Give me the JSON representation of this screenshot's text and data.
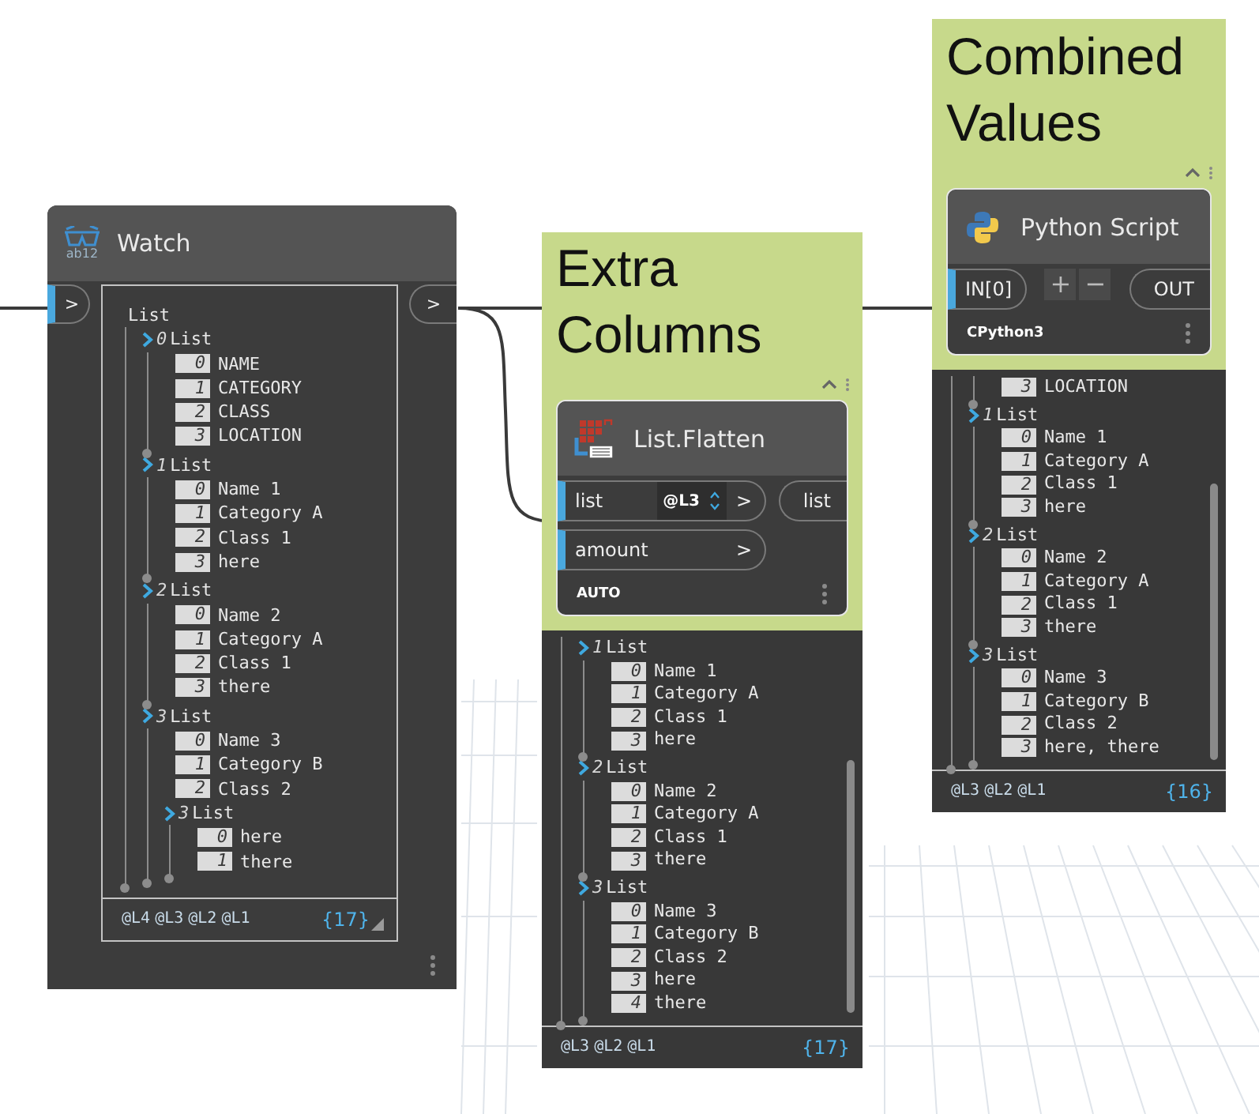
{
  "watch": {
    "title": "Watch",
    "icon_text": "ab12",
    "input_port": ">",
    "output_port": ">",
    "tree": {
      "label": "List",
      "children": [
        {
          "index": "0",
          "label": "List",
          "children": [
            {
              "index": "0",
              "text": "NAME"
            },
            {
              "index": "1",
              "text": "CATEGORY"
            },
            {
              "index": "2",
              "text": "CLASS"
            },
            {
              "index": "3",
              "text": "LOCATION"
            }
          ]
        },
        {
          "index": "1",
          "label": "List",
          "children": [
            {
              "index": "0",
              "text": "Name 1"
            },
            {
              "index": "1",
              "text": "Category A"
            },
            {
              "index": "2",
              "text": "Class 1"
            },
            {
              "index": "3",
              "text": "here"
            }
          ]
        },
        {
          "index": "2",
          "label": "List",
          "children": [
            {
              "index": "0",
              "text": "Name 2"
            },
            {
              "index": "1",
              "text": "Category A"
            },
            {
              "index": "2",
              "text": "Class 1"
            },
            {
              "index": "3",
              "text": "there"
            }
          ]
        },
        {
          "index": "3",
          "label": "List",
          "children": [
            {
              "index": "0",
              "text": "Name 3"
            },
            {
              "index": "1",
              "text": "Category B"
            },
            {
              "index": "2",
              "text": "Class 2"
            },
            {
              "index": "3",
              "label": "List",
              "children": [
                {
                  "index": "0",
                  "text": "here"
                },
                {
                  "index": "1",
                  "text": "there"
                }
              ]
            }
          ]
        }
      ]
    },
    "levels": [
      "@L4",
      "@L3",
      "@L2",
      "@L1"
    ],
    "count": "{17}"
  },
  "groups": [
    {
      "title": "Extra Columns",
      "node": {
        "kind": "flatten",
        "title": "List.Flatten",
        "inputs": [
          {
            "name": "list",
            "lacing": "@L3",
            "arrow": ">"
          },
          {
            "name": "amount",
            "arrow": ">"
          }
        ],
        "outputs": [
          "list"
        ],
        "footer": "AUTO"
      },
      "preview": {
        "tree": {
          "children": [
            {
              "index": "1",
              "label": "List",
              "children": [
                {
                  "index": "0",
                  "text": "Name 1"
                },
                {
                  "index": "1",
                  "text": "Category A"
                },
                {
                  "index": "2",
                  "text": "Class 1"
                },
                {
                  "index": "3",
                  "text": "here"
                }
              ]
            },
            {
              "index": "2",
              "label": "List",
              "children": [
                {
                  "index": "0",
                  "text": "Name 2"
                },
                {
                  "index": "1",
                  "text": "Category A"
                },
                {
                  "index": "2",
                  "text": "Class 1"
                },
                {
                  "index": "3",
                  "text": "there"
                }
              ]
            },
            {
              "index": "3",
              "label": "List",
              "children": [
                {
                  "index": "0",
                  "text": "Name 3"
                },
                {
                  "index": "1",
                  "text": "Category B"
                },
                {
                  "index": "2",
                  "text": "Class 2"
                },
                {
                  "index": "3",
                  "text": "here"
                },
                {
                  "index": "4",
                  "text": "there"
                }
              ]
            }
          ]
        },
        "levels": [
          "@L3",
          "@L2",
          "@L1"
        ],
        "count": "{17}"
      }
    },
    {
      "title": "Combined Values",
      "node": {
        "kind": "python",
        "title": "Python Script",
        "inputs": [
          {
            "name": "IN[0]"
          }
        ],
        "add": "+",
        "remove": "−",
        "outputs": [
          "OUT"
        ],
        "footer": "CPython3"
      },
      "preview": {
        "tree": {
          "children": [
            {
              "children": [
                {
                  "index": "3",
                  "text": "LOCATION"
                }
              ]
            },
            {
              "index": "1",
              "label": "List",
              "children": [
                {
                  "index": "0",
                  "text": "Name 1"
                },
                {
                  "index": "1",
                  "text": "Category A"
                },
                {
                  "index": "2",
                  "text": "Class 1"
                },
                {
                  "index": "3",
                  "text": "here"
                }
              ]
            },
            {
              "index": "2",
              "label": "List",
              "children": [
                {
                  "index": "0",
                  "text": "Name 2"
                },
                {
                  "index": "1",
                  "text": "Category A"
                },
                {
                  "index": "2",
                  "text": "Class 1"
                },
                {
                  "index": "3",
                  "text": "there"
                }
              ]
            },
            {
              "index": "3",
              "label": "List",
              "children": [
                {
                  "index": "0",
                  "text": "Name 3"
                },
                {
                  "index": "1",
                  "text": "Category B"
                },
                {
                  "index": "2",
                  "text": "Class 2"
                },
                {
                  "index": "3",
                  "text": "here, there"
                }
              ]
            }
          ]
        },
        "levels": [
          "@L3",
          "@L2",
          "@L1"
        ],
        "count": "{16}"
      }
    }
  ]
}
